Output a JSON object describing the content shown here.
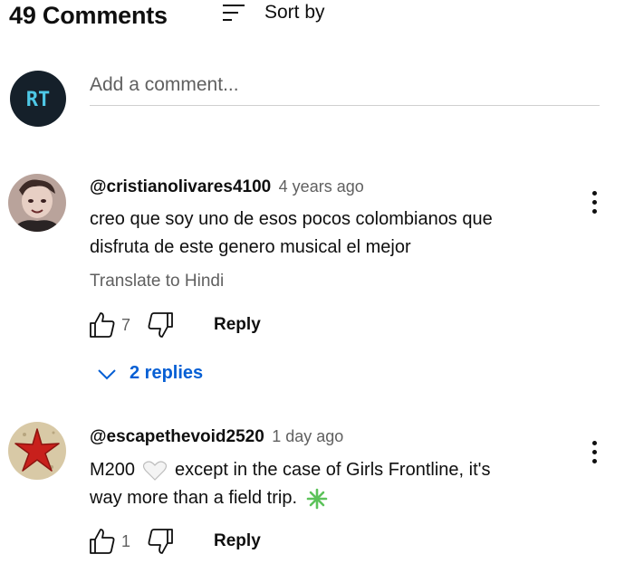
{
  "header": {
    "comment_count": "49 Comments",
    "sort_label": "Sort by"
  },
  "composer": {
    "placeholder": "Add a comment...",
    "avatar_text": "RT"
  },
  "comments": [
    {
      "handle": "@cristianolivares4100",
      "time": "4 years ago",
      "lines": [
        "creo que soy uno de esos pocos colombianos que",
        "disfruta de este genero musical el mejor"
      ],
      "translate": "Translate to Hindi",
      "likes": "7",
      "reply_label": "Reply",
      "replies_label": "2 replies"
    },
    {
      "handle": "@escapethevoid2520",
      "time": "1 day ago",
      "text_part1": "M200",
      "text_part2": "except in the case of Girls Frontline, it's",
      "line2": "way more than a field trip.",
      "likes": "1",
      "reply_label": "Reply"
    }
  ],
  "colors": {
    "link_blue": "#065fd4",
    "secondary_text": "#606060",
    "avatar_bg": "#15202a",
    "rt_logo": "#4ec8e6"
  }
}
